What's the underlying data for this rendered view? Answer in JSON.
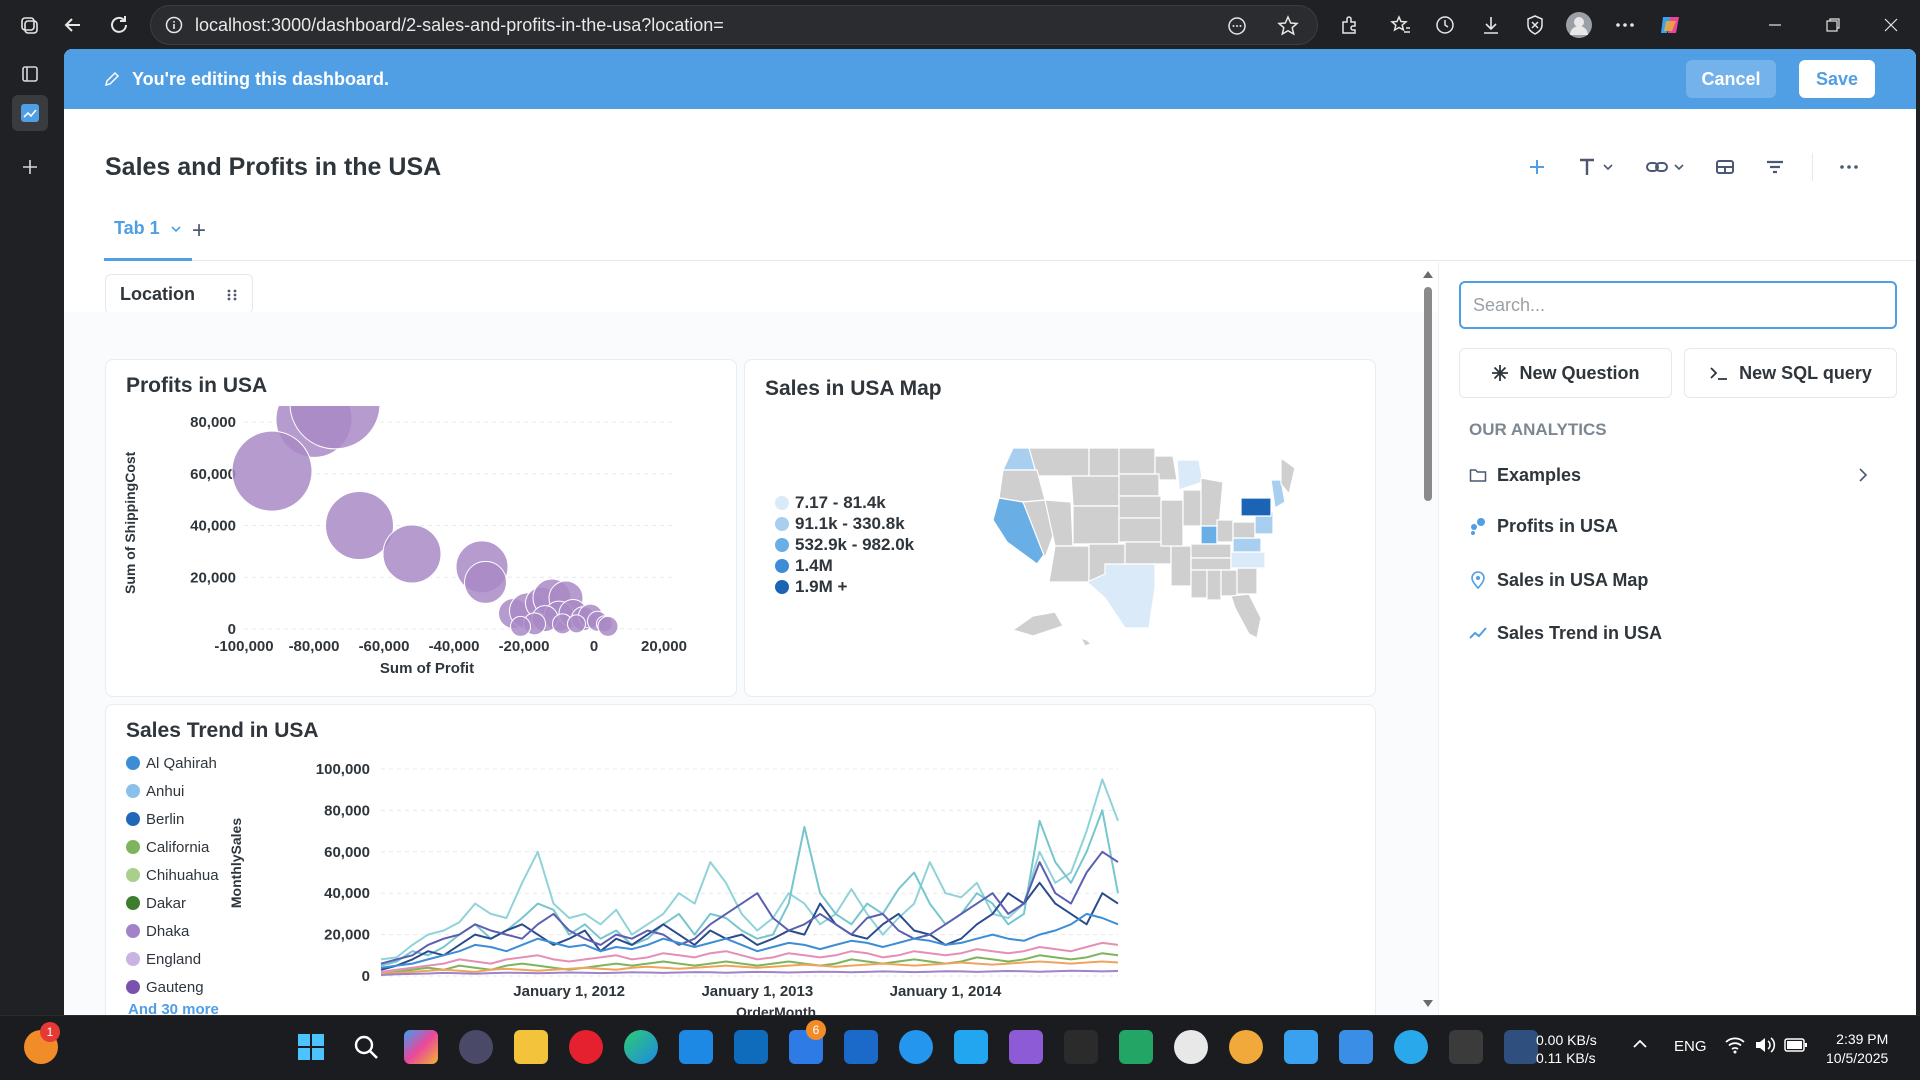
{
  "browser": {
    "url": "localhost:3000/dashboard/2-sales-and-profits-in-the-usa?location="
  },
  "banner": {
    "text": "You're editing this dashboard.",
    "cancel_label": "Cancel",
    "save_label": "Save"
  },
  "dashboard": {
    "title": "Sales and Profits in the USA",
    "tab_label": "Tab 1",
    "tab_add": "+",
    "filter_label": "Location"
  },
  "cards": {
    "profits": {
      "title": "Profits in USA",
      "xlabel": "Sum of Profit",
      "ylabel": "Sum of ShippingCost"
    },
    "map": {
      "title": "Sales in USA Map",
      "legend": [
        {
          "label": "7.17 - 81.4k",
          "color": "#dbeaf8"
        },
        {
          "label": "91.1k - 330.8k",
          "color": "#a9cff0"
        },
        {
          "label": "532.9k - 982.0k",
          "color": "#6aaee6"
        },
        {
          "label": "1.4M",
          "color": "#3d8dd6"
        },
        {
          "label": "1.9M +",
          "color": "#1b64b5"
        }
      ]
    },
    "trend": {
      "title": "Sales Trend in USA",
      "xlabel": "OrderMonth",
      "ylabel": "MonthlySales",
      "more_link": "And 30 more",
      "legend": [
        {
          "label": "Al Qahirah",
          "color": "#3d8dd6"
        },
        {
          "label": "Anhui",
          "color": "#8ac0ec"
        },
        {
          "label": "Berlin",
          "color": "#2166b8"
        },
        {
          "label": "California",
          "color": "#7eb55c"
        },
        {
          "label": "Chihuahua",
          "color": "#a8d08a"
        },
        {
          "label": "Dakar",
          "color": "#3f7d2e"
        },
        {
          "label": "Dhaka",
          "color": "#a083c9"
        },
        {
          "label": "England",
          "color": "#c9b3e3"
        },
        {
          "label": "Gauteng",
          "color": "#7a52ad"
        }
      ]
    }
  },
  "chart_data": [
    {
      "type": "scatter",
      "title": "Profits in USA",
      "xlabel": "Sum of Profit",
      "ylabel": "Sum of ShippingCost",
      "xlim": [
        -100000,
        20000
      ],
      "ylim": [
        0,
        80000
      ],
      "x_ticks": [
        "-100,000",
        "-80,000",
        "-60,000",
        "-40,000",
        "-20,000",
        "0",
        "20,000"
      ],
      "y_ticks": [
        "0",
        "20,000",
        "40,000",
        "60,000",
        "80,000"
      ],
      "points": [
        {
          "x": -80000,
          "y": 81000,
          "r": 38
        },
        {
          "x": -74000,
          "y": 87000,
          "r": 45
        },
        {
          "x": -92000,
          "y": 61000,
          "r": 40
        },
        {
          "x": -67000,
          "y": 40000,
          "r": 34
        },
        {
          "x": -52000,
          "y": 29000,
          "r": 29
        },
        {
          "x": -32000,
          "y": 24000,
          "r": 26
        },
        {
          "x": -31000,
          "y": 18000,
          "r": 21
        },
        {
          "x": -23000,
          "y": 6000,
          "r": 15
        },
        {
          "x": -19000,
          "y": 7000,
          "r": 18
        },
        {
          "x": -15000,
          "y": 10000,
          "r": 16
        },
        {
          "x": -12000,
          "y": 12000,
          "r": 19
        },
        {
          "x": -8000,
          "y": 12000,
          "r": 17
        },
        {
          "x": -10000,
          "y": 5000,
          "r": 15
        },
        {
          "x": -14000,
          "y": 4000,
          "r": 13
        },
        {
          "x": -6000,
          "y": 6000,
          "r": 14
        },
        {
          "x": -3000,
          "y": 4000,
          "r": 12
        },
        {
          "x": -1000,
          "y": 5000,
          "r": 12
        },
        {
          "x": 1000,
          "y": 3000,
          "r": 10
        },
        {
          "x": 3000,
          "y": 2000,
          "r": 8
        },
        {
          "x": 4000,
          "y": 1000,
          "r": 10
        },
        {
          "x": -17000,
          "y": 2000,
          "r": 11
        },
        {
          "x": -21000,
          "y": 1000,
          "r": 10
        },
        {
          "x": -9000,
          "y": 2000,
          "r": 10
        },
        {
          "x": -5000,
          "y": 2000,
          "r": 9
        }
      ]
    },
    {
      "type": "line",
      "title": "Sales Trend in USA",
      "xlabel": "OrderMonth",
      "ylabel": "MonthlySales",
      "ylim": [
        0,
        100000
      ],
      "y_ticks": [
        "0",
        "20,000",
        "40,000",
        "60,000",
        "80,000",
        "100,000"
      ],
      "x_ticks": [
        {
          "label": "January 1, 2012",
          "month": 12
        },
        {
          "label": "January 1, 2013",
          "month": 24
        },
        {
          "label": "January 1, 2014",
          "month": 36
        }
      ],
      "months": 48,
      "series": [
        {
          "color": "#8fd3d9",
          "values": [
            8000,
            9000,
            15000,
            20000,
            22000,
            26000,
            35000,
            30000,
            28000,
            45000,
            60000,
            35000,
            28000,
            30000,
            25000,
            32000,
            20000,
            25000,
            30000,
            40000,
            35000,
            55000,
            45000,
            30000,
            22000,
            28000,
            40000,
            35000,
            25000,
            30000,
            42000,
            30000,
            20000,
            28000,
            35000,
            55000,
            40000,
            38000,
            45000,
            30000,
            28000,
            35000,
            60000,
            45000,
            50000,
            70000,
            95000,
            75000
          ]
        },
        {
          "color": "#76c6ce",
          "values": [
            5000,
            7000,
            12000,
            10000,
            14000,
            20000,
            25000,
            18000,
            22000,
            28000,
            35000,
            32000,
            20000,
            25000,
            18000,
            22000,
            15000,
            18000,
            25000,
            30000,
            20000,
            30000,
            28000,
            22000,
            18000,
            20000,
            35000,
            72000,
            40000,
            30000,
            25000,
            35000,
            30000,
            42000,
            50000,
            35000,
            25000,
            30000,
            40000,
            35000,
            25000,
            30000,
            75000,
            55000,
            45000,
            60000,
            80000,
            40000
          ]
        },
        {
          "color": "#2a4b8c",
          "values": [
            3000,
            5000,
            8000,
            12000,
            10000,
            15000,
            20000,
            18000,
            22000,
            25000,
            20000,
            15000,
            18000,
            22000,
            12000,
            18000,
            15000,
            20000,
            25000,
            20000,
            15000,
            22000,
            18000,
            20000,
            15000,
            18000,
            22000,
            20000,
            35000,
            25000,
            20000,
            18000,
            25000,
            30000,
            22000,
            20000,
            15000,
            18000,
            25000,
            30000,
            40000,
            35000,
            45000,
            35000,
            30000,
            25000,
            40000,
            35000
          ]
        },
        {
          "color": "#5b5fb0",
          "values": [
            6000,
            8000,
            10000,
            15000,
            18000,
            20000,
            25000,
            22000,
            20000,
            18000,
            25000,
            30000,
            22000,
            18000,
            15000,
            20000,
            18000,
            22000,
            20000,
            15000,
            18000,
            25000,
            30000,
            35000,
            40000,
            28000,
            22000,
            25000,
            30000,
            25000,
            20000,
            28000,
            30000,
            22000,
            18000,
            20000,
            25000,
            30000,
            35000,
            40000,
            30000,
            35000,
            55000,
            40000,
            35000,
            50000,
            60000,
            55000
          ]
        },
        {
          "color": "#3d8dd6",
          "values": [
            4000,
            5000,
            6000,
            8000,
            10000,
            12000,
            15000,
            14000,
            12000,
            15000,
            18000,
            16000,
            14000,
            15000,
            12000,
            14000,
            13000,
            15000,
            18000,
            16000,
            14000,
            16000,
            18000,
            15000,
            12000,
            14000,
            16000,
            15000,
            13000,
            15000,
            17000,
            16000,
            14000,
            16000,
            18000,
            17000,
            15000,
            16000,
            18000,
            20000,
            18000,
            17000,
            20000,
            22000,
            25000,
            30000,
            28000,
            25000
          ]
        },
        {
          "color": "#e58fb5",
          "values": [
            2000,
            3000,
            4000,
            5000,
            6000,
            8000,
            7000,
            6000,
            8000,
            9000,
            10000,
            8000,
            7000,
            8000,
            9000,
            10000,
            8000,
            9000,
            11000,
            10000,
            9000,
            11000,
            12000,
            10000,
            8000,
            9000,
            11000,
            10000,
            9000,
            10000,
            12000,
            11000,
            9000,
            10000,
            12000,
            11000,
            10000,
            11000,
            13000,
            12000,
            11000,
            12000,
            14000,
            13000,
            12000,
            14000,
            16000,
            15000
          ]
        },
        {
          "color": "#7eb55c",
          "values": [
            1000,
            2000,
            3000,
            4000,
            3000,
            5000,
            4000,
            3000,
            5000,
            6000,
            5000,
            4000,
            3000,
            4000,
            5000,
            6000,
            5000,
            6000,
            7000,
            6000,
            5000,
            6000,
            7000,
            6000,
            5000,
            6000,
            7000,
            6000,
            5000,
            6000,
            8000,
            7000,
            6000,
            7000,
            8000,
            7000,
            6000,
            7000,
            9000,
            8000,
            7000,
            8000,
            10000,
            9000,
            8000,
            9000,
            11000,
            10000
          ]
        },
        {
          "color": "#f0a35a",
          "values": [
            1000,
            1500,
            2000,
            2500,
            3000,
            2500,
            2000,
            3000,
            3500,
            3000,
            2500,
            3000,
            3500,
            4000,
            3500,
            3000,
            4000,
            4500,
            4000,
            3500,
            4000,
            4500,
            5000,
            4500,
            4000,
            4500,
            5000,
            5500,
            5000,
            4500,
            5000,
            5500,
            6000,
            5500,
            5000,
            5500,
            6000,
            6500,
            6000,
            5500,
            6000,
            6500,
            7000,
            6500,
            6000,
            6500,
            7000,
            6500
          ]
        },
        {
          "color": "#a083c9",
          "values": [
            500,
            800,
            1000,
            1200,
            1500,
            1300,
            1100,
            1400,
            1600,
            1500,
            1300,
            1500,
            1700,
            1600,
            1400,
            1600,
            1800,
            1700,
            1500,
            1700,
            1900,
            1800,
            1600,
            1800,
            2000,
            1900,
            1700,
            1900,
            2100,
            2000,
            1800,
            2000,
            2200,
            2100,
            1900,
            2100,
            2300,
            2200,
            2000,
            2200,
            2400,
            2300,
            2100,
            2300,
            2500,
            2400,
            2200,
            2400
          ]
        }
      ]
    }
  ],
  "sidebar": {
    "search_placeholder": "Search...",
    "new_question": "New Question",
    "new_sql": "New SQL query",
    "section_title": "OUR ANALYTICS",
    "items": [
      {
        "label": "Examples"
      },
      {
        "label": "Profits in USA"
      },
      {
        "label": "Sales in USA Map"
      },
      {
        "label": "Sales Trend in USA"
      }
    ]
  },
  "taskbar": {
    "net_up": "0.00 KB/s",
    "net_down": "0.11 KB/s",
    "lang": "ENG",
    "time": "2:39 PM",
    "date": "10/5/2025",
    "badge_a": "1",
    "badge_b": "6"
  }
}
